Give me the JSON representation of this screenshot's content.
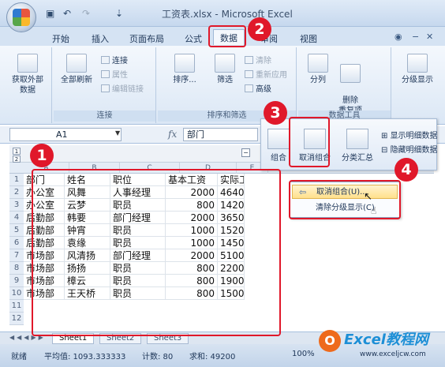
{
  "window": {
    "title": "工资表.xlsx - Microsoft Excel"
  },
  "ribbon": {
    "tabs": [
      "开始",
      "插入",
      "页面布局",
      "公式",
      "数据",
      "审阅",
      "视图"
    ],
    "active_tab": "数据",
    "groups": {
      "get_external": {
        "label": "获取\n外部数据",
        "button": "获取外部数据"
      },
      "connections": {
        "label": "连接",
        "refresh_all": "全部刷新",
        "connections_btn": "连接",
        "properties_btn": "属性",
        "edit_links_btn": "编辑链接"
      },
      "sort_filter": {
        "label": "排序和筛选",
        "sort": "排序...",
        "filter": "筛选",
        "clear": "清除",
        "reapply": "重新应用",
        "advanced": "高级"
      },
      "data_tools": {
        "label": "数据工具",
        "text_to_columns": "分列",
        "remove_duplicates": "删除\n重复项"
      },
      "outline": {
        "label": "分级显示",
        "button": "分级显示"
      }
    }
  },
  "formula_bar": {
    "name_box": "A1",
    "fx": "fx",
    "content": "部门"
  },
  "outline_panel": {
    "group": "组合",
    "ungroup": "取消组合",
    "subtotal": "分类汇总",
    "show_detail": "显示明细数据",
    "hide_detail": "隐藏明细数据"
  },
  "context_menu": {
    "items": [
      "取消组合(U)...",
      "清除分级显示(C)"
    ]
  },
  "sheet": {
    "outline_levels": [
      "1",
      "2"
    ],
    "collapse_symbol": "−",
    "columns": [
      "A",
      "B",
      "C",
      "D",
      "E"
    ],
    "row_numbers": [
      "1",
      "2",
      "3",
      "4",
      "5",
      "6",
      "7",
      "8",
      "9",
      "10",
      "11",
      "12"
    ],
    "header": [
      "部门",
      "姓名",
      "职位",
      "基本工资",
      "实际工"
    ],
    "rows": [
      [
        "办公室",
        "风舞",
        "人事经理",
        "2000",
        "4640"
      ],
      [
        "办公室",
        "云梦",
        "职员",
        "800",
        "1420"
      ],
      [
        "后勤部",
        "韩要",
        "部门经理",
        "2000",
        "3650"
      ],
      [
        "后勤部",
        "钟宵",
        "职员",
        "1000",
        "1520"
      ],
      [
        "后勤部",
        "袁缘",
        "职员",
        "1000",
        "1450"
      ],
      [
        "市场部",
        "风清扬",
        "部门经理",
        "2000",
        "5100"
      ],
      [
        "市场部",
        "扬扬",
        "职员",
        "800",
        "2200"
      ],
      [
        "市场部",
        "樟云",
        "职员",
        "800",
        "1900"
      ],
      [
        "市场部",
        "王天桥",
        "职员",
        "800",
        "1500"
      ]
    ]
  },
  "sheet_tabs": [
    "Sheet1",
    "Sheet2",
    "Sheet3"
  ],
  "active_sheet": "Sheet1",
  "status_bar": {
    "ready": "就绪",
    "average": "平均值: 1093.333333",
    "count": "计数: 80",
    "sum": "求和: 49200",
    "zoom": "100%"
  },
  "annotations": {
    "badges": [
      "1",
      "2",
      "3",
      "4"
    ],
    "color": "#e0182a"
  },
  "watermark": {
    "logo_letter": "O",
    "title": "Excel教程网",
    "url": "www.exceljcw.com"
  }
}
